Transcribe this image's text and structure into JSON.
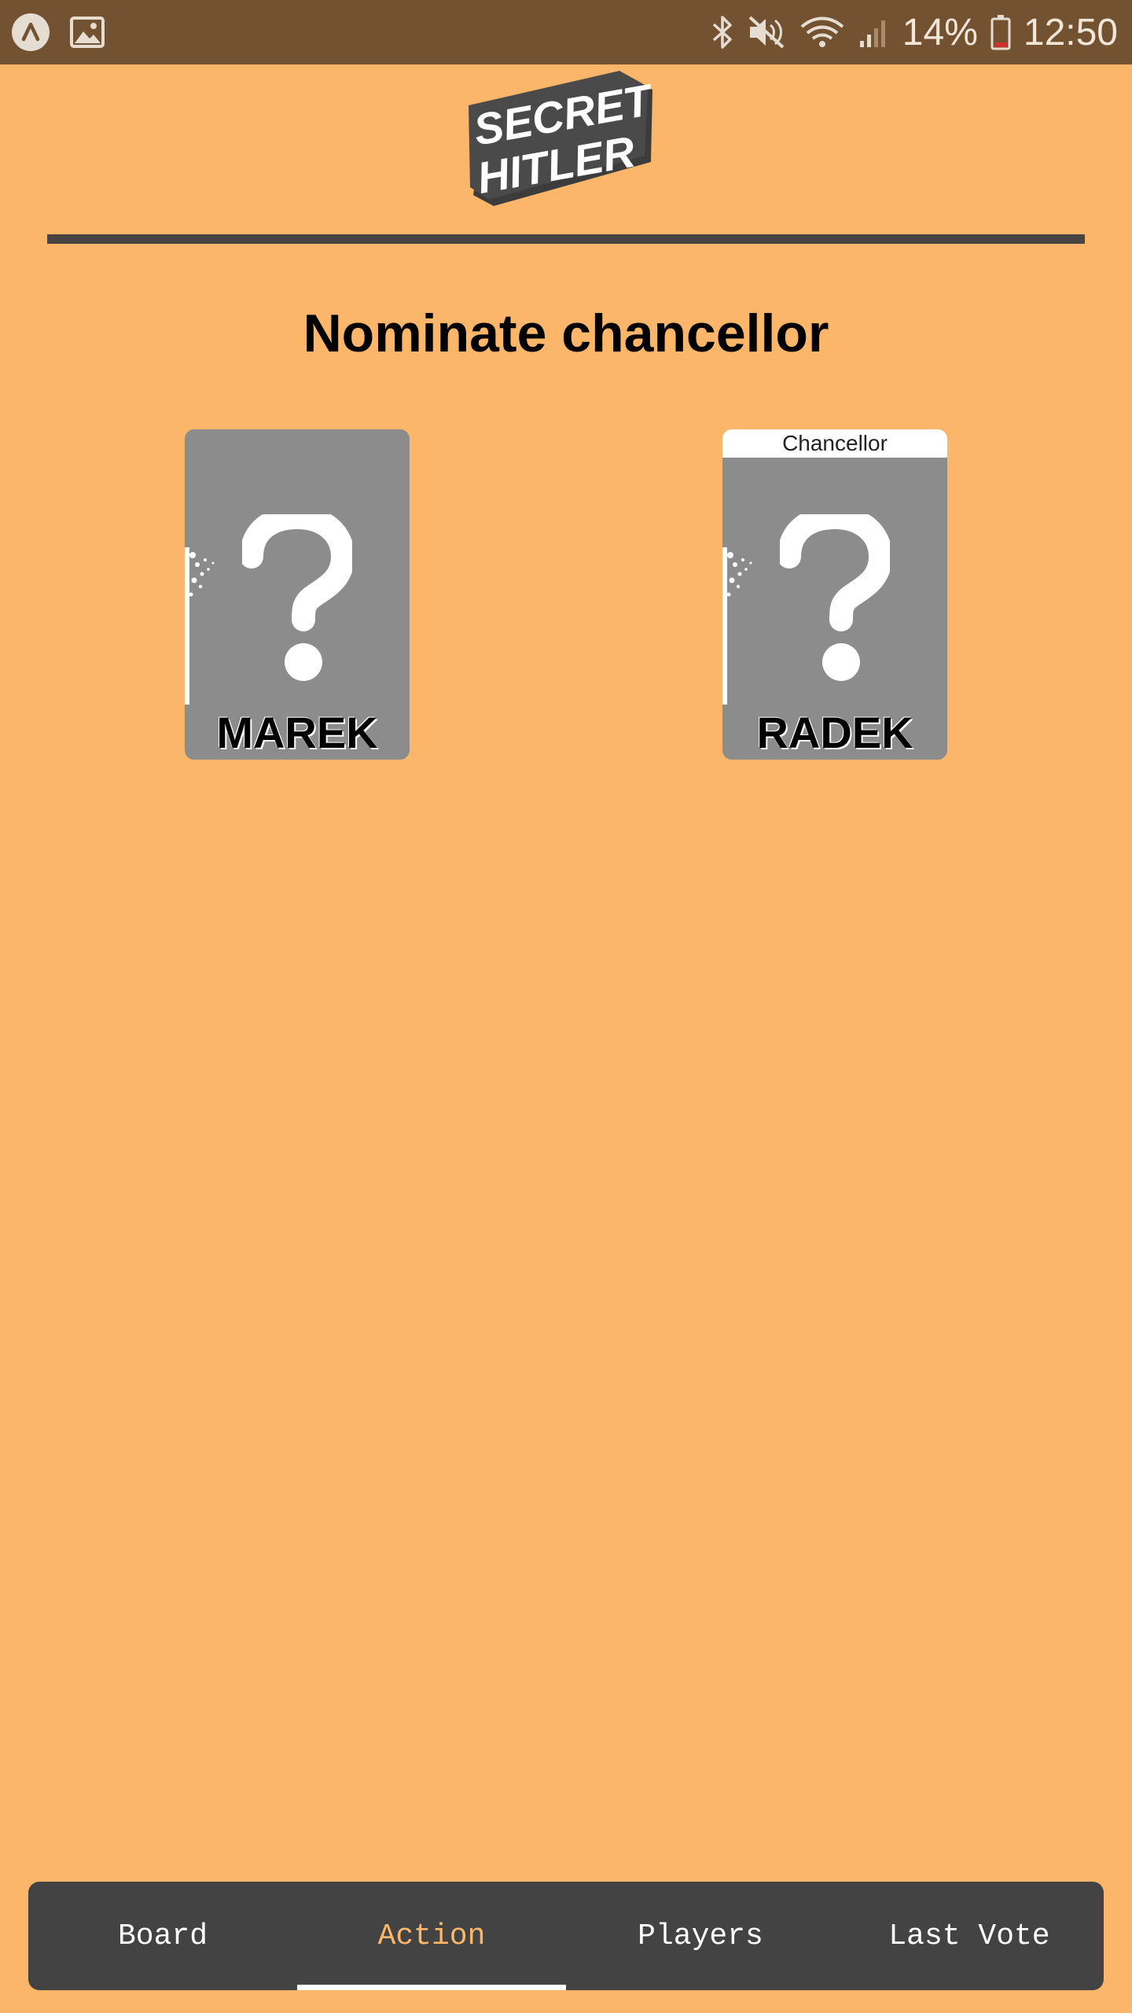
{
  "status_bar": {
    "battery_percent": "14%",
    "time": "12:50",
    "icons": [
      "assistant-icon",
      "image-icon",
      "bluetooth-icon",
      "mute-icon",
      "wifi-icon",
      "signal-icon",
      "battery-icon"
    ]
  },
  "header": {
    "logo_line1": "SECRET",
    "logo_line2": "HITLER"
  },
  "main": {
    "title": "Nominate chancellor",
    "players": [
      {
        "name": "MAREK",
        "badge": ""
      },
      {
        "name": "RADEK",
        "badge": "Chancellor"
      }
    ]
  },
  "tabs": [
    {
      "label": "Board",
      "active": false
    },
    {
      "label": "Action",
      "active": true
    },
    {
      "label": "Players",
      "active": false
    },
    {
      "label": "Last Vote",
      "active": false
    }
  ],
  "colors": {
    "background": "#FBB66A",
    "status_bar": "#735231",
    "tab_bar": "#434343",
    "active_tab": "#FBB66A",
    "card": "#8C8C8C"
  }
}
